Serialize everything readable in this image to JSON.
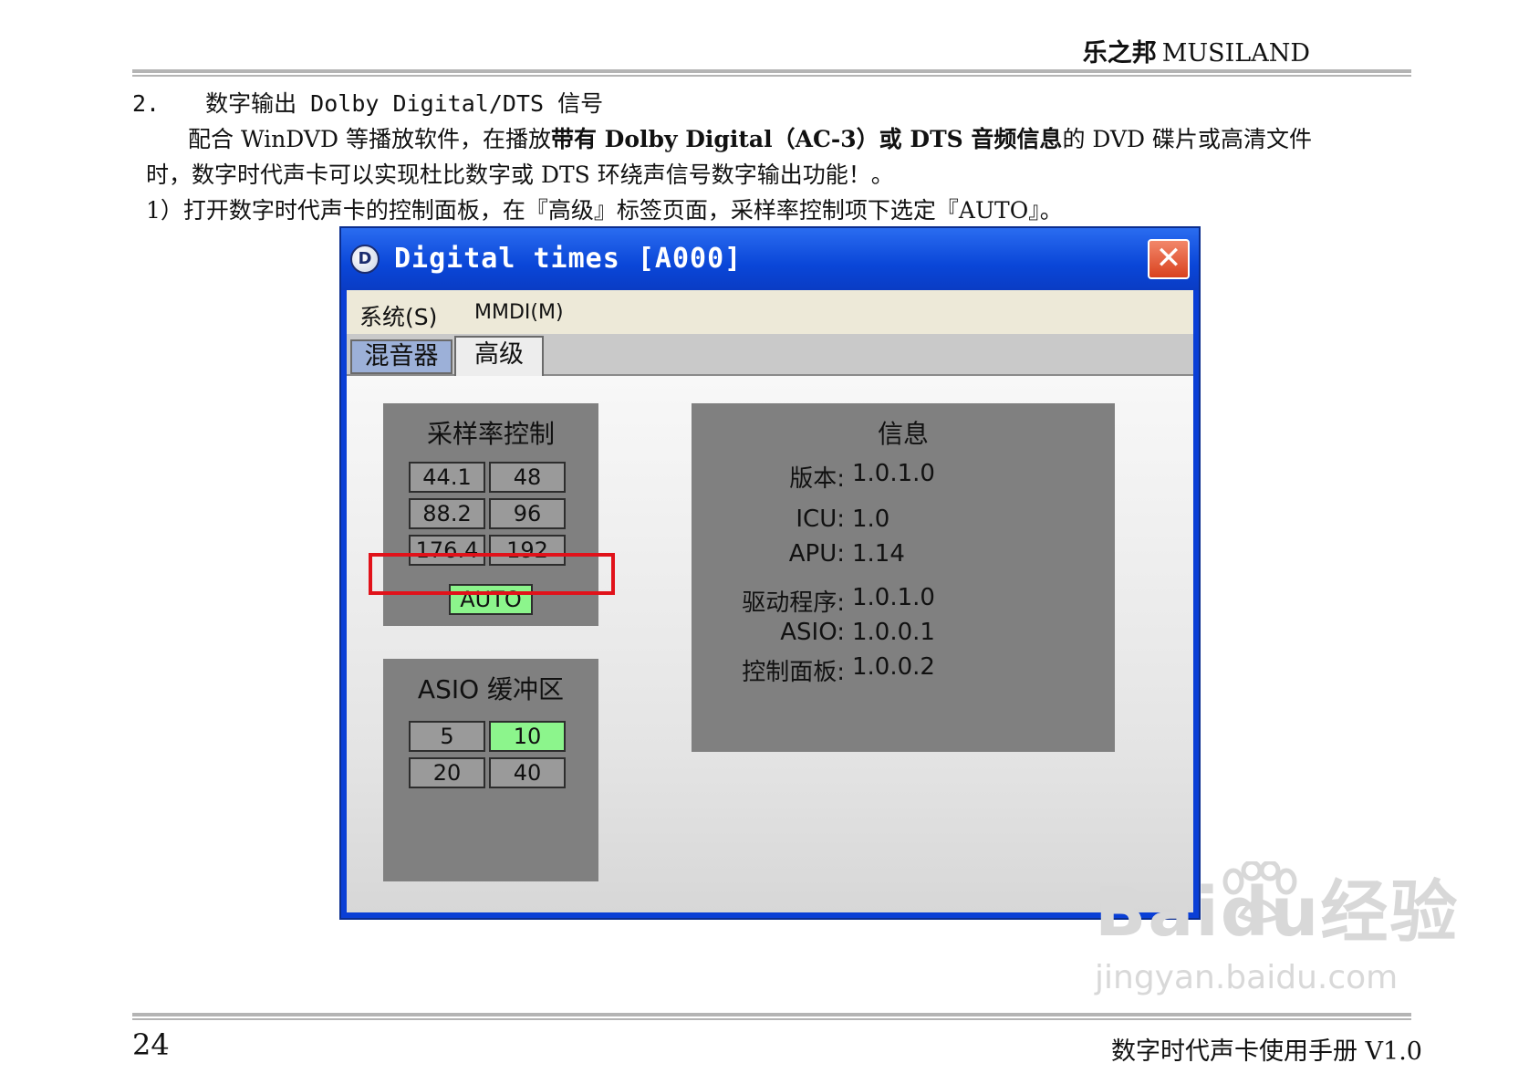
{
  "header": {
    "brand_cn": "乐之邦",
    "brand_en": "MUSILAND"
  },
  "content": {
    "section_num": "2.",
    "section_title": "数字输出 Dolby Digital/DTS 信号",
    "para_a": "配合 WinDVD 等播放软件，在播放",
    "para_bold": "带有 Dolby Digital（AC-3）或 DTS 音频信息",
    "para_b": "的 DVD 碟片或高清文件",
    "para_line2": "时，数字时代声卡可以实现杜比数字或 DTS 环绕声信号数字输出功能！。",
    "step1": "1）打开数字时代声卡的控制面板，在『高级』标签页面，采样率控制项下选定『AUTO』。"
  },
  "window": {
    "title": "Digital times [A000]",
    "icon": "D",
    "close_glyph": "✕",
    "menus": [
      "系统(S)",
      "MMDI(M)"
    ],
    "tabs": [
      "混音器",
      "高级"
    ],
    "sample_rate": {
      "title": "采样率控制",
      "rates": [
        "44.1",
        "48",
        "88.2",
        "96",
        "176.4",
        "192"
      ],
      "auto": "AUTO",
      "selected": "AUTO"
    },
    "asio": {
      "title": "ASIO 缓冲区",
      "sizes": [
        "5",
        "10",
        "20",
        "40"
      ],
      "selected": "10"
    },
    "info": {
      "title": "信息",
      "rows": [
        {
          "key": "版本:",
          "value": "1.0.1.0"
        },
        {
          "key": "ICU:",
          "value": "1.0"
        },
        {
          "key": "APU:",
          "value": "1.14"
        },
        {
          "key": "驱动程序:",
          "value": "1.0.1.0"
        },
        {
          "key": "ASIO:",
          "value": "1.0.0.1"
        },
        {
          "key": "控制面板:",
          "value": "1.0.0.2"
        }
      ]
    },
    "highlight_color": "#e1121a",
    "active_color": "#8cf58c"
  },
  "footer": {
    "page": "24",
    "title": "数字时代声卡使用手册 V1.0"
  },
  "watermark": {
    "line1": "Baidu经验",
    "line2": "jingyan.baidu.com"
  }
}
